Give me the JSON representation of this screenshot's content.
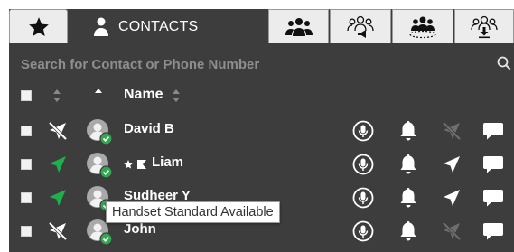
{
  "tabs": {
    "contacts_label": "CONTACTS"
  },
  "search": {
    "placeholder": "Search for Contact or Phone Number"
  },
  "table": {
    "name_header": "Name"
  },
  "contacts": [
    {
      "name": "David B",
      "favorite": false,
      "location_enabled": false,
      "location_icon": "location-off-icon",
      "muted_location_action": true
    },
    {
      "name": "Liam",
      "favorite": true,
      "flag": true,
      "location_enabled": true,
      "location_icon": "location-on-icon",
      "muted_location_action": false
    },
    {
      "name": "Sudheer Y",
      "favorite": false,
      "location_enabled": true,
      "location_icon": "location-on-icon",
      "muted_location_action": false
    },
    {
      "name": "John",
      "favorite": false,
      "location_enabled": false,
      "location_icon": "location-off-icon",
      "muted_location_action": true
    }
  ],
  "tooltip": {
    "text": "Handset Standard Available"
  },
  "colors": {
    "background": "#3d3d3d",
    "tab_inactive": "#ececec",
    "text": "#ffffff",
    "placeholder": "#8e8e8e",
    "status_green": "#2fa84f",
    "location_on_green": "#1fb04b",
    "muted_icon": "#6f6f6f"
  }
}
